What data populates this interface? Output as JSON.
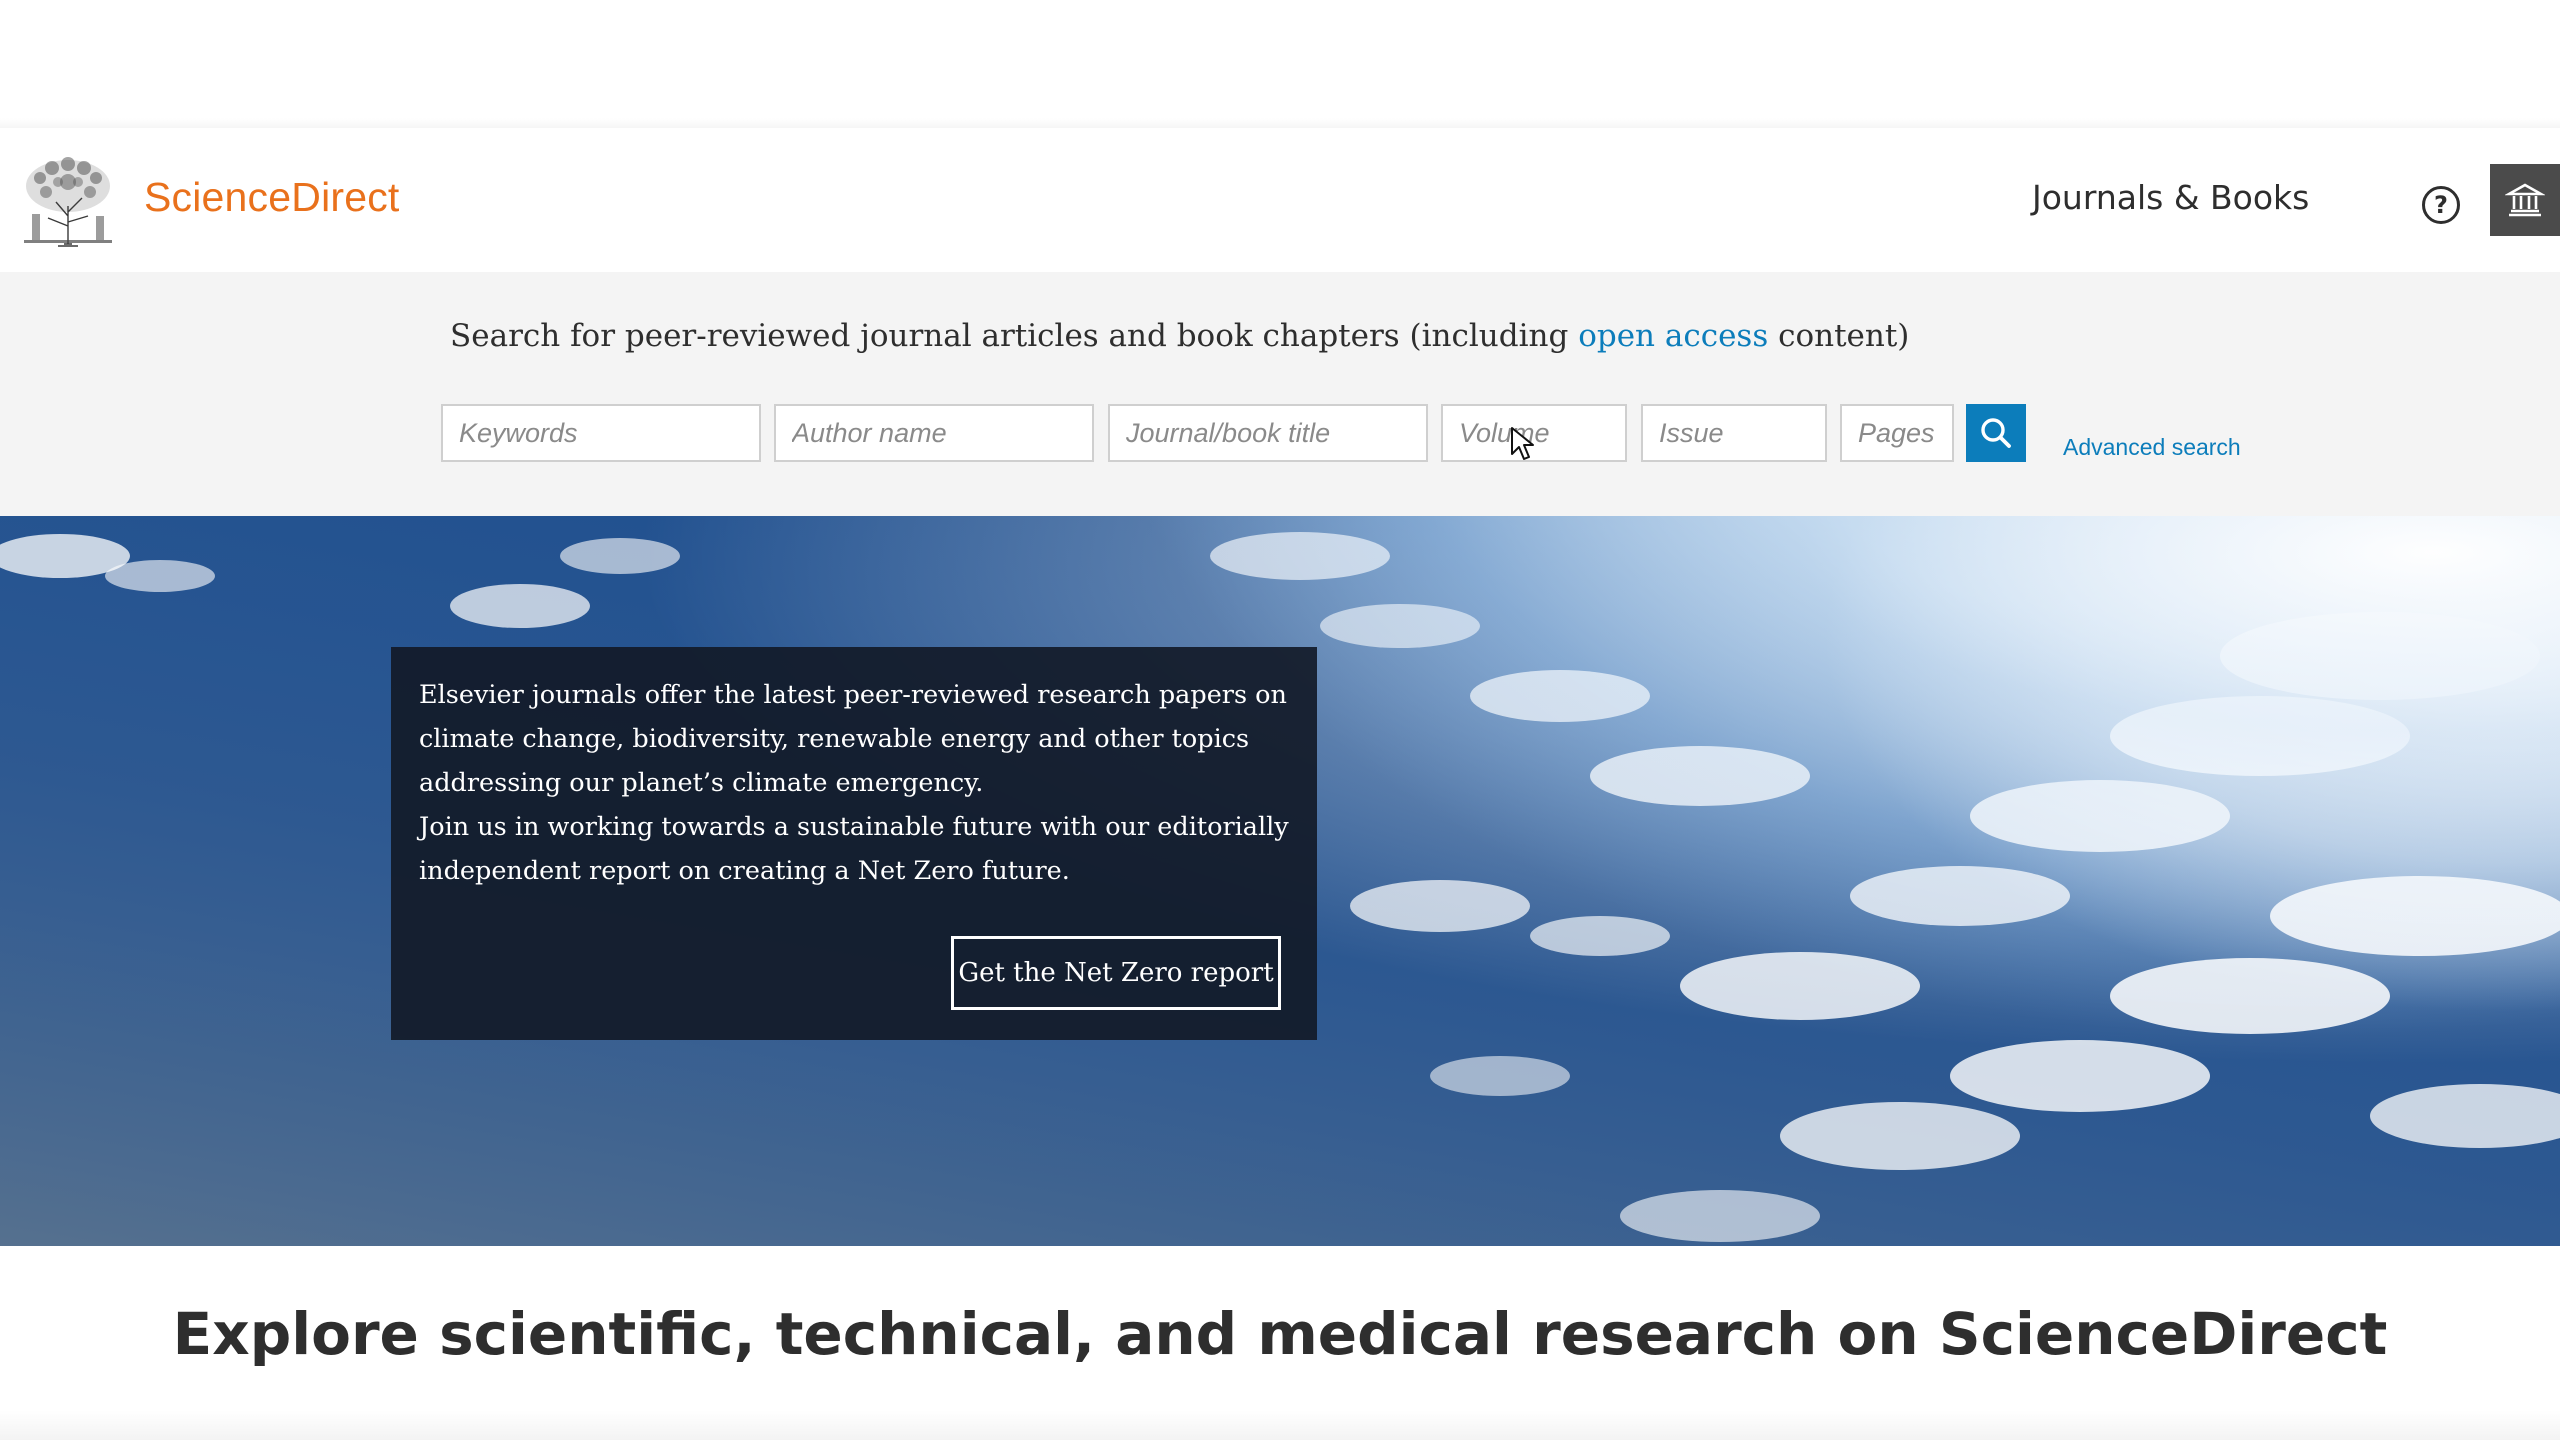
{
  "header": {
    "brand": "ScienceDirect",
    "nav_journals_books": "Journals & Books",
    "help_icon": "question-circle-icon",
    "institution_icon": "institution-building-icon"
  },
  "search": {
    "intro_before": "Search for peer-reviewed journal articles and book chapters (including ",
    "intro_link": "open access",
    "intro_after": " content)",
    "keywords_placeholder": "Keywords",
    "author_placeholder": "Author name",
    "journal_placeholder": "Journal/book title",
    "volume_placeholder": "Volume",
    "issue_placeholder": "Issue",
    "pages_placeholder": "Pages",
    "search_icon": "search-icon",
    "advanced_search": "Advanced search"
  },
  "hero": {
    "paragraph_1": "Elsevier journals offer the latest peer-reviewed research papers on climate change, biodiversity, renewable energy and other topics addressing our planet’s climate emergency.",
    "paragraph_2": "Join us in working towards a sustainable future with our editorially independent report on creating a Net Zero future.",
    "cta_button": "Get the Net Zero report"
  },
  "explore": {
    "title": "Explore scientific, technical, and medical research on ScienceDirect"
  },
  "colors": {
    "brand_orange": "#e9711c",
    "link_blue": "#0c7dbb",
    "text_dark": "#2e2e2e"
  }
}
